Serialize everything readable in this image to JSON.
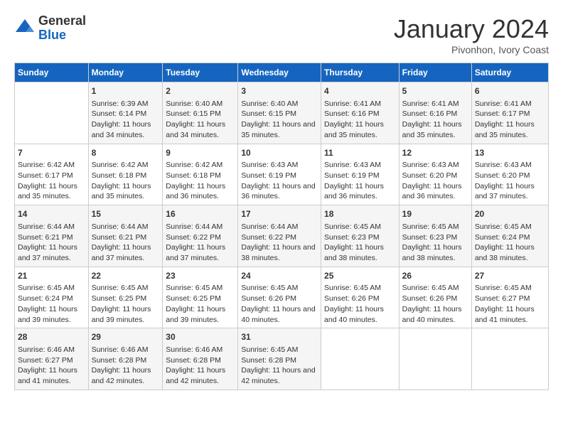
{
  "header": {
    "logo": {
      "general": "General",
      "blue": "Blue"
    },
    "title": "January 2024",
    "subtitle": "Pivonhon, Ivory Coast"
  },
  "days_of_week": [
    "Sunday",
    "Monday",
    "Tuesday",
    "Wednesday",
    "Thursday",
    "Friday",
    "Saturday"
  ],
  "weeks": [
    [
      {
        "day": "",
        "empty": true
      },
      {
        "day": "1",
        "sunrise": "Sunrise: 6:39 AM",
        "sunset": "Sunset: 6:14 PM",
        "daylight": "Daylight: 11 hours and 34 minutes."
      },
      {
        "day": "2",
        "sunrise": "Sunrise: 6:40 AM",
        "sunset": "Sunset: 6:15 PM",
        "daylight": "Daylight: 11 hours and 34 minutes."
      },
      {
        "day": "3",
        "sunrise": "Sunrise: 6:40 AM",
        "sunset": "Sunset: 6:15 PM",
        "daylight": "Daylight: 11 hours and 35 minutes."
      },
      {
        "day": "4",
        "sunrise": "Sunrise: 6:41 AM",
        "sunset": "Sunset: 6:16 PM",
        "daylight": "Daylight: 11 hours and 35 minutes."
      },
      {
        "day": "5",
        "sunrise": "Sunrise: 6:41 AM",
        "sunset": "Sunset: 6:16 PM",
        "daylight": "Daylight: 11 hours and 35 minutes."
      },
      {
        "day": "6",
        "sunrise": "Sunrise: 6:41 AM",
        "sunset": "Sunset: 6:17 PM",
        "daylight": "Daylight: 11 hours and 35 minutes."
      }
    ],
    [
      {
        "day": "7",
        "sunrise": "Sunrise: 6:42 AM",
        "sunset": "Sunset: 6:17 PM",
        "daylight": "Daylight: 11 hours and 35 minutes."
      },
      {
        "day": "8",
        "sunrise": "Sunrise: 6:42 AM",
        "sunset": "Sunset: 6:18 PM",
        "daylight": "Daylight: 11 hours and 35 minutes."
      },
      {
        "day": "9",
        "sunrise": "Sunrise: 6:42 AM",
        "sunset": "Sunset: 6:18 PM",
        "daylight": "Daylight: 11 hours and 36 minutes."
      },
      {
        "day": "10",
        "sunrise": "Sunrise: 6:43 AM",
        "sunset": "Sunset: 6:19 PM",
        "daylight": "Daylight: 11 hours and 36 minutes."
      },
      {
        "day": "11",
        "sunrise": "Sunrise: 6:43 AM",
        "sunset": "Sunset: 6:19 PM",
        "daylight": "Daylight: 11 hours and 36 minutes."
      },
      {
        "day": "12",
        "sunrise": "Sunrise: 6:43 AM",
        "sunset": "Sunset: 6:20 PM",
        "daylight": "Daylight: 11 hours and 36 minutes."
      },
      {
        "day": "13",
        "sunrise": "Sunrise: 6:43 AM",
        "sunset": "Sunset: 6:20 PM",
        "daylight": "Daylight: 11 hours and 37 minutes."
      }
    ],
    [
      {
        "day": "14",
        "sunrise": "Sunrise: 6:44 AM",
        "sunset": "Sunset: 6:21 PM",
        "daylight": "Daylight: 11 hours and 37 minutes."
      },
      {
        "day": "15",
        "sunrise": "Sunrise: 6:44 AM",
        "sunset": "Sunset: 6:21 PM",
        "daylight": "Daylight: 11 hours and 37 minutes."
      },
      {
        "day": "16",
        "sunrise": "Sunrise: 6:44 AM",
        "sunset": "Sunset: 6:22 PM",
        "daylight": "Daylight: 11 hours and 37 minutes."
      },
      {
        "day": "17",
        "sunrise": "Sunrise: 6:44 AM",
        "sunset": "Sunset: 6:22 PM",
        "daylight": "Daylight: 11 hours and 38 minutes."
      },
      {
        "day": "18",
        "sunrise": "Sunrise: 6:45 AM",
        "sunset": "Sunset: 6:23 PM",
        "daylight": "Daylight: 11 hours and 38 minutes."
      },
      {
        "day": "19",
        "sunrise": "Sunrise: 6:45 AM",
        "sunset": "Sunset: 6:23 PM",
        "daylight": "Daylight: 11 hours and 38 minutes."
      },
      {
        "day": "20",
        "sunrise": "Sunrise: 6:45 AM",
        "sunset": "Sunset: 6:24 PM",
        "daylight": "Daylight: 11 hours and 38 minutes."
      }
    ],
    [
      {
        "day": "21",
        "sunrise": "Sunrise: 6:45 AM",
        "sunset": "Sunset: 6:24 PM",
        "daylight": "Daylight: 11 hours and 39 minutes."
      },
      {
        "day": "22",
        "sunrise": "Sunrise: 6:45 AM",
        "sunset": "Sunset: 6:25 PM",
        "daylight": "Daylight: 11 hours and 39 minutes."
      },
      {
        "day": "23",
        "sunrise": "Sunrise: 6:45 AM",
        "sunset": "Sunset: 6:25 PM",
        "daylight": "Daylight: 11 hours and 39 minutes."
      },
      {
        "day": "24",
        "sunrise": "Sunrise: 6:45 AM",
        "sunset": "Sunset: 6:26 PM",
        "daylight": "Daylight: 11 hours and 40 minutes."
      },
      {
        "day": "25",
        "sunrise": "Sunrise: 6:45 AM",
        "sunset": "Sunset: 6:26 PM",
        "daylight": "Daylight: 11 hours and 40 minutes."
      },
      {
        "day": "26",
        "sunrise": "Sunrise: 6:45 AM",
        "sunset": "Sunset: 6:26 PM",
        "daylight": "Daylight: 11 hours and 40 minutes."
      },
      {
        "day": "27",
        "sunrise": "Sunrise: 6:45 AM",
        "sunset": "Sunset: 6:27 PM",
        "daylight": "Daylight: 11 hours and 41 minutes."
      }
    ],
    [
      {
        "day": "28",
        "sunrise": "Sunrise: 6:46 AM",
        "sunset": "Sunset: 6:27 PM",
        "daylight": "Daylight: 11 hours and 41 minutes."
      },
      {
        "day": "29",
        "sunrise": "Sunrise: 6:46 AM",
        "sunset": "Sunset: 6:28 PM",
        "daylight": "Daylight: 11 hours and 42 minutes."
      },
      {
        "day": "30",
        "sunrise": "Sunrise: 6:46 AM",
        "sunset": "Sunset: 6:28 PM",
        "daylight": "Daylight: 11 hours and 42 minutes."
      },
      {
        "day": "31",
        "sunrise": "Sunrise: 6:45 AM",
        "sunset": "Sunset: 6:28 PM",
        "daylight": "Daylight: 11 hours and 42 minutes."
      },
      {
        "day": "",
        "empty": true
      },
      {
        "day": "",
        "empty": true
      },
      {
        "day": "",
        "empty": true
      }
    ]
  ]
}
